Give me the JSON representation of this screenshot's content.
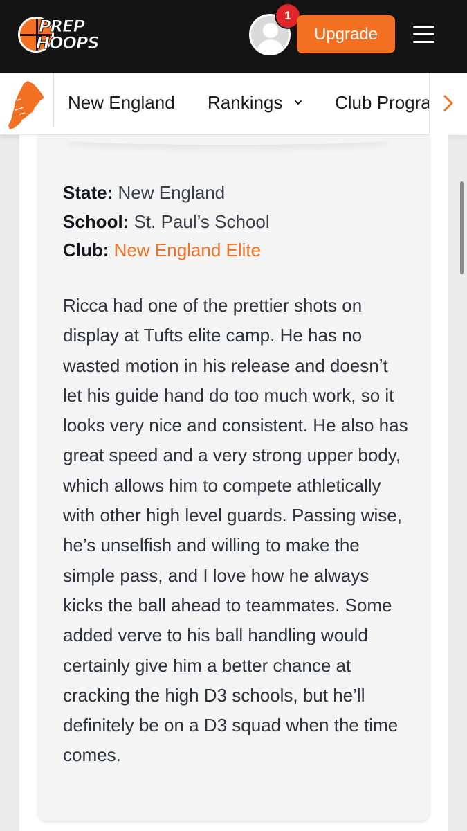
{
  "header": {
    "logo_text_line1": "PREP",
    "logo_text_line2": "HOOPS",
    "notification_count": "1",
    "upgrade_label": "Upgrade"
  },
  "subnav": {
    "region_label": "New England",
    "rankings_label": "Rankings",
    "club_label": "Club Programs"
  },
  "profile": {
    "state_label": "State:",
    "state_value": "New England",
    "school_label": "School:",
    "school_value": "St. Paul’s School",
    "club_label": "Club:",
    "club_value": "New England Elite"
  },
  "article": {
    "body": "Ricca had one of the prettier shots on display at Tufts elite camp. He has no wasted motion in his release and doesn’t let his guide hand do too much work, so it looks very nice and consistent. He also has great speed and a very strong upper body, which allows him to compete athletically with other high level guards. Passing wise, he’s unselfish and willing to make the simple pass, and I love how he always kicks the ball ahead to teammates. Some added verve to his ball handling would certainly give him a better chance at cracking the high D3 schools, but he’ll definitely be on a D3 squad when the time comes."
  },
  "colors": {
    "brand_orange": "#f36f21",
    "header_bg": "#141414",
    "badge_red": "#e2242b"
  },
  "icons": [
    "prep-hoops-logo",
    "user-avatar-icon",
    "hamburger-menu-icon",
    "new-england-map-icon",
    "chevron-down-icon",
    "chevron-right-icon"
  ]
}
